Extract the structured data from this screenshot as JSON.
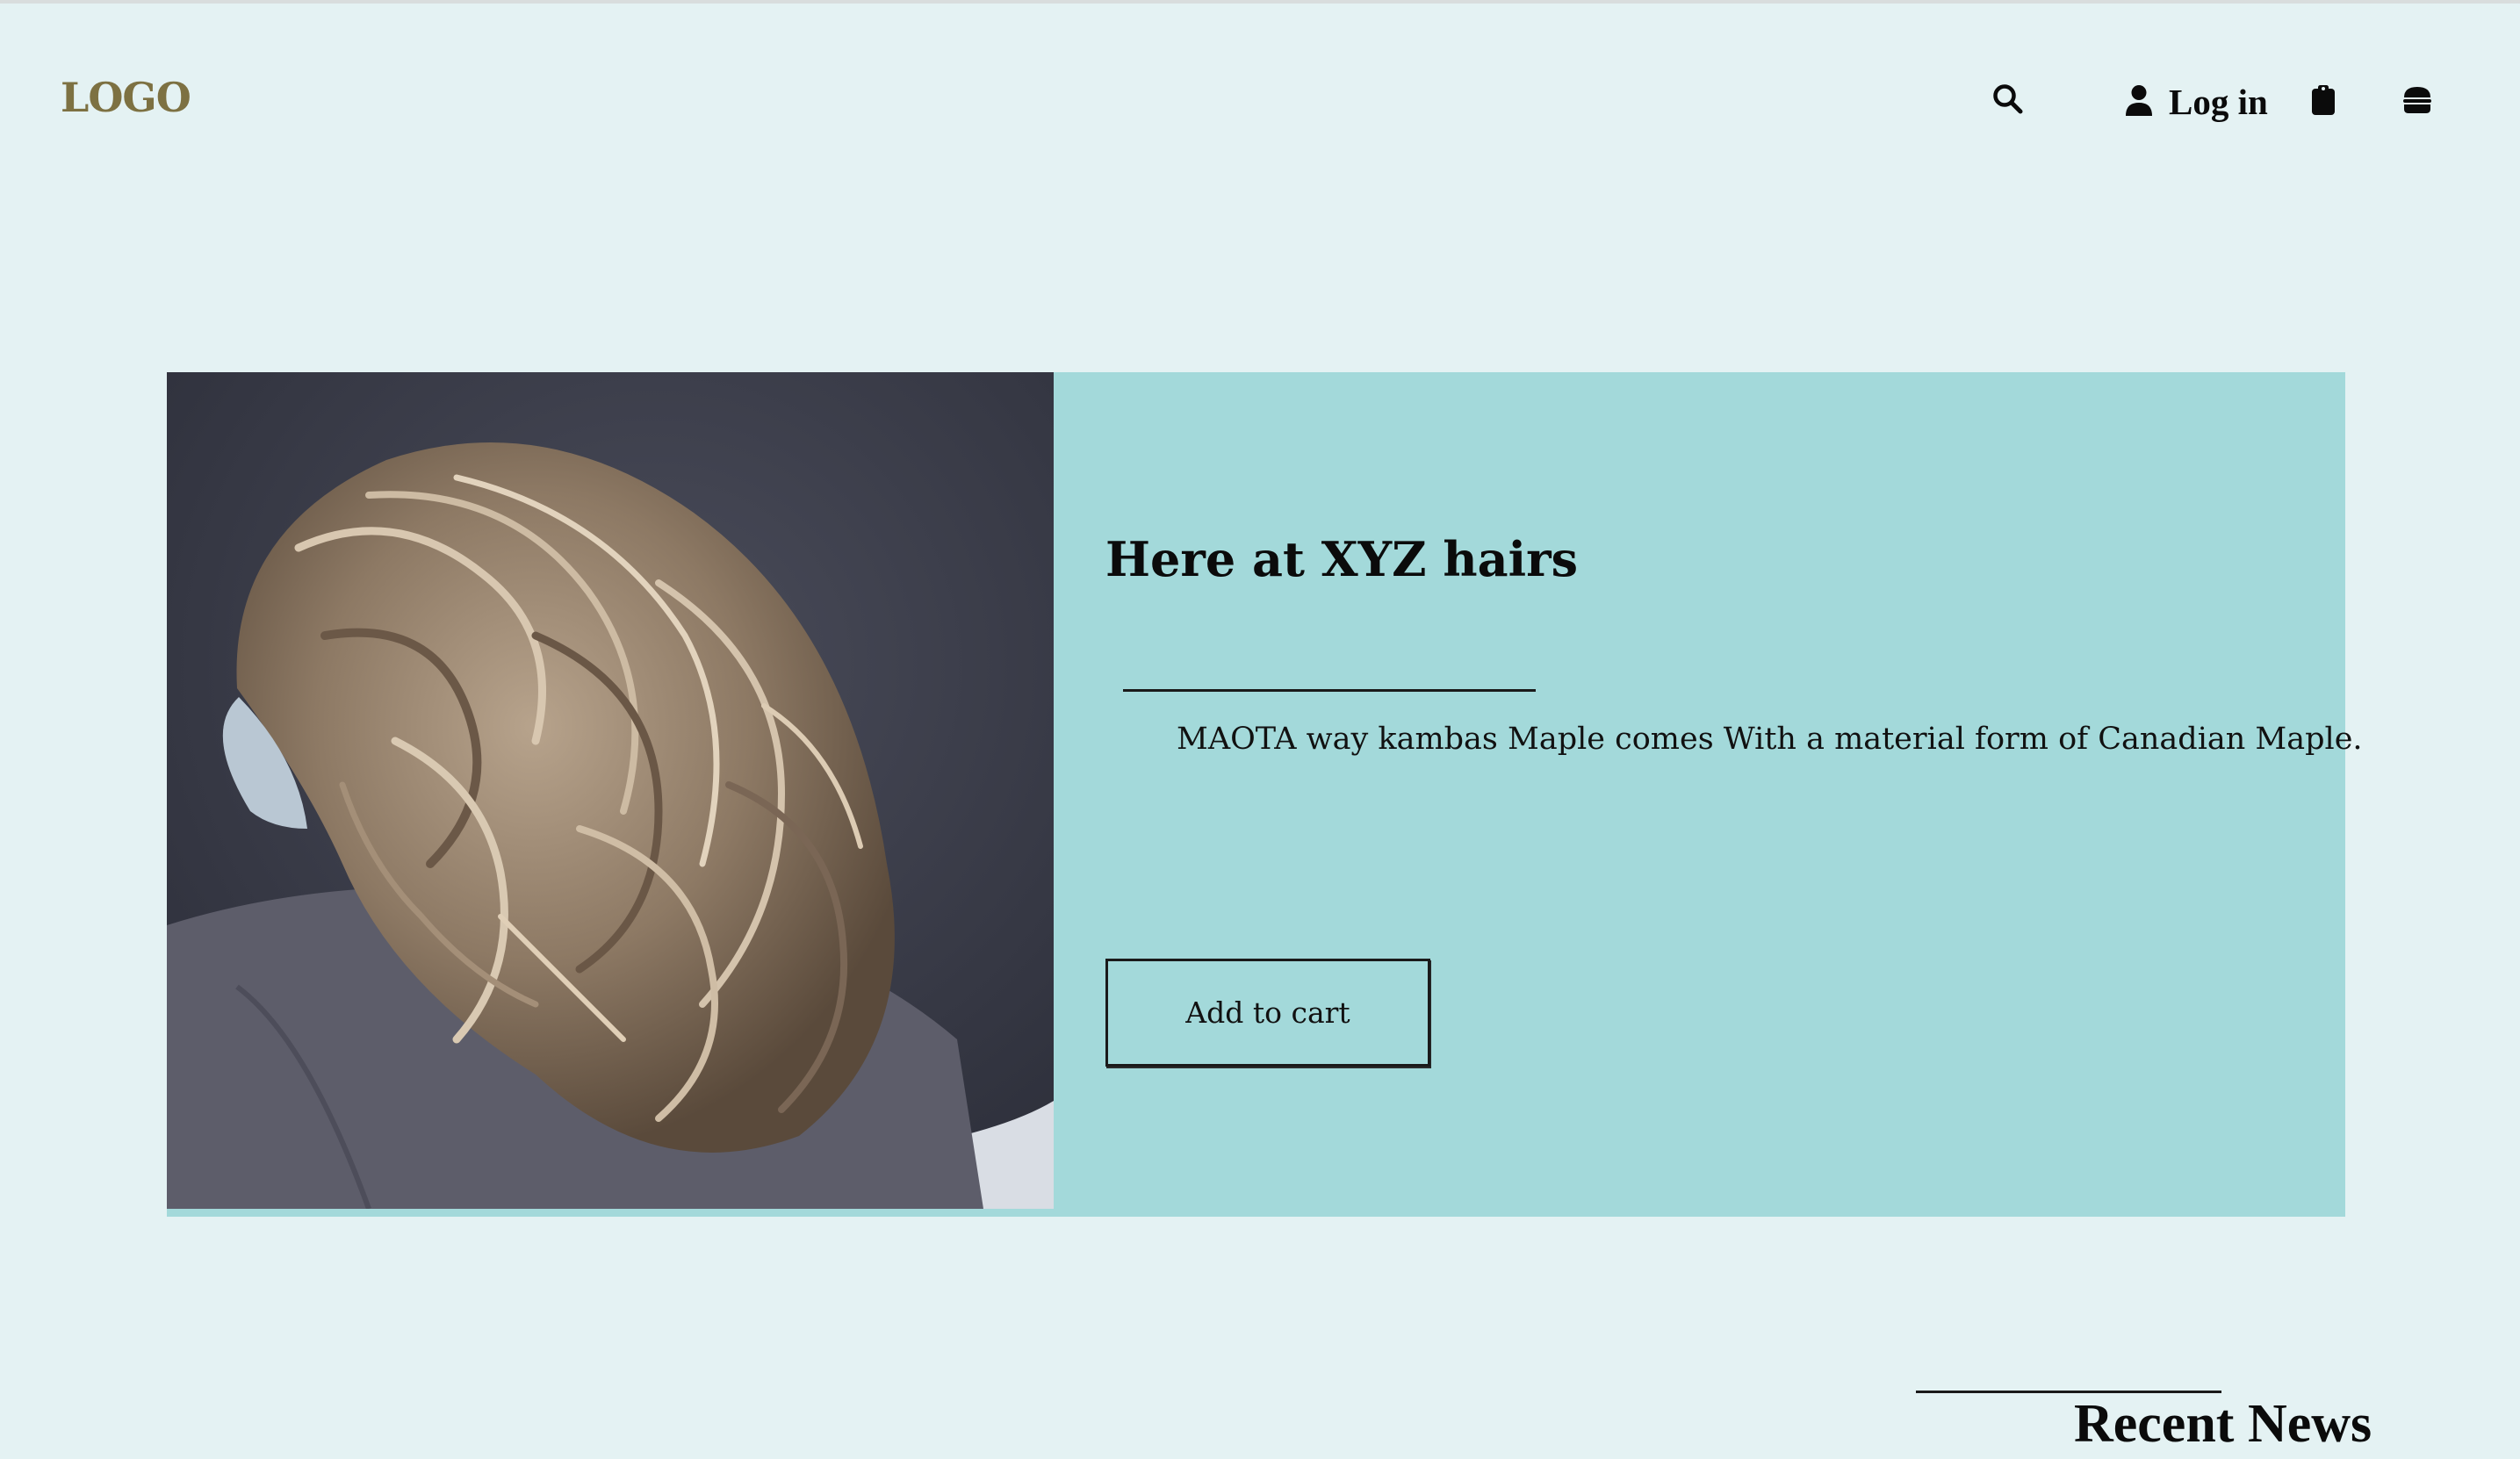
{
  "header": {
    "logo": "LOGO",
    "login_label": "Log in",
    "icons": [
      "search-icon",
      "user-icon",
      "clipboard-icon",
      "hamburger-icon"
    ]
  },
  "hero": {
    "image_alt": "Woman with wavy highlighted hair",
    "title": "Here at XYZ hairs",
    "description": "MAOTA way kambas Maple comes With a material form of Canadian Maple.",
    "button_label": "Add to cart"
  },
  "news": {
    "title": "Recent News"
  },
  "colors": {
    "page_background": "#e4f2f3",
    "hero_background": "#a3d9da",
    "logo": "#7d7142",
    "text": "#0b0b0b"
  }
}
